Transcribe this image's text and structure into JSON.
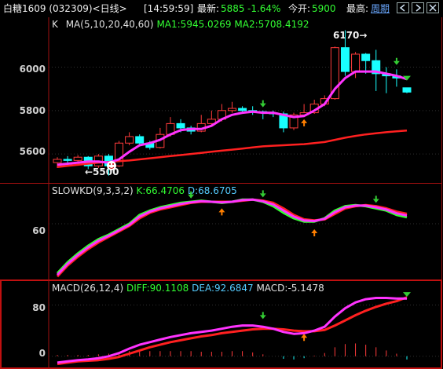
{
  "header": {
    "title": "白糖1609 (032309)<日线>",
    "time": "[14:59:59]",
    "latest_label": "最新:",
    "latest_value": "5885",
    "change": "-1.64%",
    "open_label": "今开:",
    "open_value": "5900",
    "high_label": "最高:",
    "period": "周期"
  },
  "kline": {
    "label": "K",
    "ma_label": "MA(5,10,20,40,60)",
    "ma1": "MA1:5945.0269",
    "ma2": "MA2:5708.4192",
    "y_ticks": [
      "6000",
      "5800",
      "5600"
    ],
    "high_marker": "6170→",
    "low_marker": "←5500"
  },
  "kd": {
    "label": "SLOWKD(9,3,3,2)",
    "k": "K:66.4706",
    "d": "D:68.6705",
    "y_ticks": [
      "60"
    ]
  },
  "macd": {
    "label": "MACD(26,12,4)",
    "diff": "DIFF:90.1108",
    "dea": "DEA:92.6847",
    "macd": "MACD:-5.1478",
    "y_ticks": [
      "80",
      "0"
    ]
  },
  "colors": {
    "up": "#ff3b3b",
    "down": "#19ffff",
    "ma1": "#ff33ff",
    "ma2": "#ff2020",
    "green": "#33ff33",
    "border": "#a01010",
    "arrow_up": "#ff7f00",
    "arrow_down": "#33cc33"
  },
  "chart_data": {
    "type": "candlestick",
    "candles": [
      {
        "o": 5560,
        "c": 5575,
        "h": 5585,
        "l": 5535
      },
      {
        "o": 5575,
        "c": 5570,
        "h": 5590,
        "l": 5555
      },
      {
        "o": 5570,
        "c": 5585,
        "h": 5595,
        "l": 5560
      },
      {
        "o": 5585,
        "c": 5545,
        "h": 5590,
        "l": 5530
      },
      {
        "o": 5545,
        "c": 5590,
        "h": 5600,
        "l": 5535
      },
      {
        "o": 5590,
        "c": 5545,
        "h": 5600,
        "l": 5500
      },
      {
        "o": 5545,
        "c": 5650,
        "h": 5660,
        "l": 5540
      },
      {
        "o": 5650,
        "c": 5680,
        "h": 5700,
        "l": 5640
      },
      {
        "o": 5680,
        "c": 5650,
        "h": 5690,
        "l": 5640
      },
      {
        "o": 5650,
        "c": 5630,
        "h": 5660,
        "l": 5620
      },
      {
        "o": 5630,
        "c": 5690,
        "h": 5720,
        "l": 5625
      },
      {
        "o": 5690,
        "c": 5740,
        "h": 5770,
        "l": 5680
      },
      {
        "o": 5740,
        "c": 5720,
        "h": 5760,
        "l": 5700
      },
      {
        "o": 5720,
        "c": 5705,
        "h": 5730,
        "l": 5690
      },
      {
        "o": 5705,
        "c": 5740,
        "h": 5780,
        "l": 5700
      },
      {
        "o": 5740,
        "c": 5760,
        "h": 5800,
        "l": 5730
      },
      {
        "o": 5760,
        "c": 5800,
        "h": 5830,
        "l": 5750
      },
      {
        "o": 5800,
        "c": 5810,
        "h": 5840,
        "l": 5790
      },
      {
        "o": 5810,
        "c": 5800,
        "h": 5820,
        "l": 5795
      },
      {
        "o": 5800,
        "c": 5795,
        "h": 5820,
        "l": 5780
      },
      {
        "o": 5795,
        "c": 5790,
        "h": 5800,
        "l": 5760
      },
      {
        "o": 5790,
        "c": 5785,
        "h": 5800,
        "l": 5770
      },
      {
        "o": 5785,
        "c": 5720,
        "h": 5795,
        "l": 5700
      },
      {
        "o": 5720,
        "c": 5780,
        "h": 5790,
        "l": 5710
      },
      {
        "o": 5780,
        "c": 5790,
        "h": 5830,
        "l": 5770
      },
      {
        "o": 5790,
        "c": 5830,
        "h": 5850,
        "l": 5785
      },
      {
        "o": 5830,
        "c": 5855,
        "h": 5870,
        "l": 5820
      },
      {
        "o": 5855,
        "c": 6090,
        "h": 6095,
        "l": 5850
      },
      {
        "o": 6090,
        "c": 5980,
        "h": 6170,
        "l": 5960
      },
      {
        "o": 5980,
        "c": 6060,
        "h": 6070,
        "l": 5950
      },
      {
        "o": 6060,
        "c": 6030,
        "h": 6065,
        "l": 5970
      },
      {
        "o": 6030,
        "c": 5970,
        "h": 6080,
        "l": 5890
      },
      {
        "o": 5970,
        "c": 5960,
        "h": 6000,
        "l": 5880
      },
      {
        "o": 5960,
        "c": 5950,
        "h": 5990,
        "l": 5910
      },
      {
        "o": 5905,
        "c": 5885,
        "h": 5905,
        "l": 5880
      }
    ],
    "ma1": [
      5550,
      5555,
      5560,
      5565,
      5565,
      5560,
      5575,
      5610,
      5640,
      5650,
      5665,
      5690,
      5710,
      5715,
      5715,
      5730,
      5760,
      5780,
      5790,
      5795,
      5790,
      5790,
      5780,
      5770,
      5775,
      5800,
      5830,
      5900,
      5950,
      5980,
      5980,
      5980,
      5970,
      5960,
      5945
    ],
    "ma2": [
      5540,
      5545,
      5550,
      5555,
      5560,
      5563,
      5567,
      5570,
      5575,
      5580,
      5585,
      5590,
      5595,
      5600,
      5605,
      5610,
      5615,
      5620,
      5625,
      5630,
      5635,
      5638,
      5640,
      5643,
      5645,
      5650,
      5655,
      5665,
      5675,
      5683,
      5690,
      5695,
      5700,
      5704,
      5708
    ],
    "kd_k": [
      15,
      25,
      33,
      40,
      46,
      50,
      55,
      60,
      68,
      72,
      75,
      77,
      79,
      80,
      81,
      80,
      79,
      80,
      82,
      82,
      80,
      76,
      70,
      65,
      62,
      62,
      65,
      72,
      76,
      77,
      76,
      74,
      72,
      68,
      66
    ],
    "kd_d": [
      12,
      22,
      30,
      37,
      43,
      48,
      53,
      58,
      65,
      70,
      73,
      75,
      77,
      79,
      80,
      80,
      80,
      80,
      81,
      82,
      81,
      79,
      74,
      68,
      64,
      63,
      64,
      69,
      74,
      76,
      77,
      76,
      74,
      71,
      69
    ],
    "macd_diff": [
      -10,
      -8,
      -6,
      -5,
      -3,
      0,
      5,
      12,
      18,
      22,
      26,
      30,
      33,
      36,
      38,
      40,
      43,
      46,
      48,
      48,
      46,
      43,
      38,
      35,
      36,
      40,
      46,
      62,
      75,
      84,
      89,
      91,
      91,
      90,
      90
    ],
    "macd_dea": [
      -12,
      -10,
      -8,
      -7,
      -6,
      -4,
      -1,
      4,
      9,
      14,
      18,
      22,
      25,
      28,
      31,
      33,
      36,
      38,
      40,
      42,
      43,
      43,
      42,
      40,
      39,
      39,
      41,
      48,
      56,
      64,
      71,
      77,
      82,
      86,
      92
    ],
    "macd_bar": [
      2,
      2,
      2,
      2,
      3,
      4,
      6,
      8,
      9,
      8,
      8,
      8,
      8,
      8,
      7,
      7,
      7,
      8,
      8,
      6,
      3,
      0,
      -4,
      -5,
      -3,
      1,
      5,
      14,
      19,
      20,
      18,
      14,
      9,
      4,
      -5
    ],
    "kd_ylim": [
      10,
      95
    ],
    "macd_ylim": [
      -15,
      110
    ],
    "k_ylim": [
      5470,
      6230
    ]
  }
}
